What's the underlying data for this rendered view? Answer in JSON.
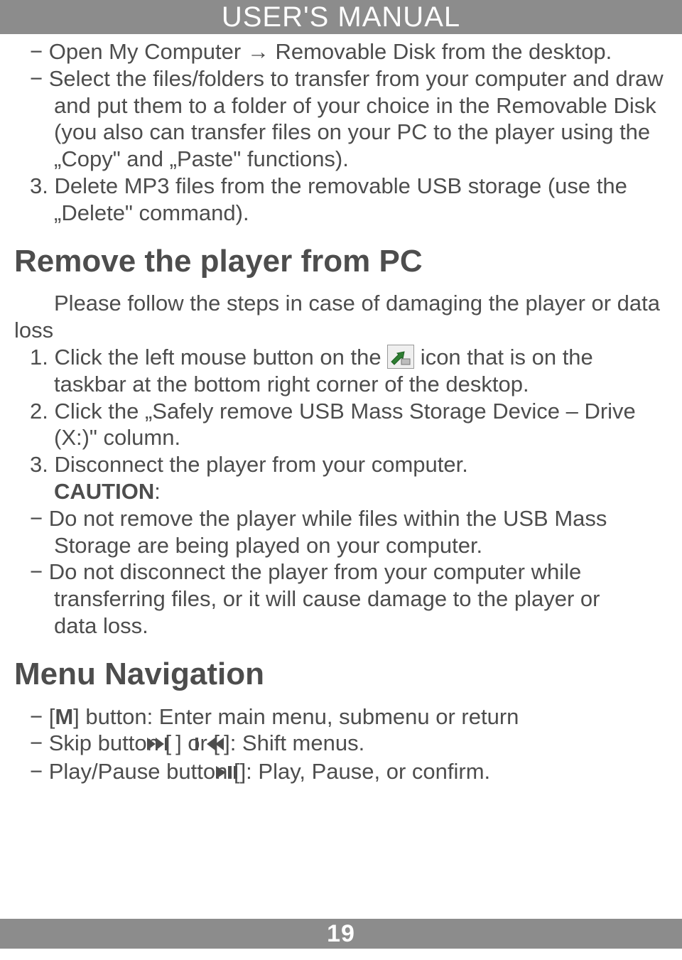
{
  "header": {
    "title": "USER'S MANUAL"
  },
  "footer": {
    "page": "19"
  },
  "s1": {
    "b1": "Open My Computer → Removable Disk from the desktop.",
    "b2_l1": "Select the files/folders to transfer from your computer and draw",
    "b2_l2": "and put them to a folder of your choice in the Removable Disk",
    "b2_l3": "(you also can transfer files on your PC to the player using the",
    "b2_l4": "„Copy\" and „Paste\" functions).",
    "n3_l1": "3. Delete MP3 files from the removable USB storage (use the",
    "n3_l2": "„Delete\" command)."
  },
  "h_remove": "Remove the player from PC",
  "s2": {
    "lead_l1": "Please follow the steps in case of damaging the player or data",
    "lead_l2": "loss",
    "n1_a": "1. Click the left mouse button on the ",
    "n1_b": " icon that is on the",
    "n1_l2": "taskbar at the bottom right corner of the desktop.",
    "n2_l1": "2. Click the „Safely remove USB Mass Storage Device – Drive",
    "n2_l2": "(X:)\" column.",
    "n3": "3. Disconnect the player from your computer.",
    "caution": "CAUTION",
    "c1_l1": "Do not remove the player while files within the USB Mass",
    "c1_l2": "Storage are being played on your computer.",
    "c2_l1": "Do not disconnect the player from your computer while",
    "c2_l2": "transferring files, or it will cause damage to the player or",
    "c2_l3": "data loss."
  },
  "h_menu": "Menu Navigation",
  "s3": {
    "b1_a": "[",
    "b1_m": "M",
    "b1_b": "] button: Enter main menu, submenu or return",
    "b2_a": "Skip button [",
    "b2_b": "] or [",
    "b2_c": "]: Shift menus.",
    "b3_a": "Play/Pause button [",
    "b3_b": "]: Play, Pause, or confirm."
  }
}
